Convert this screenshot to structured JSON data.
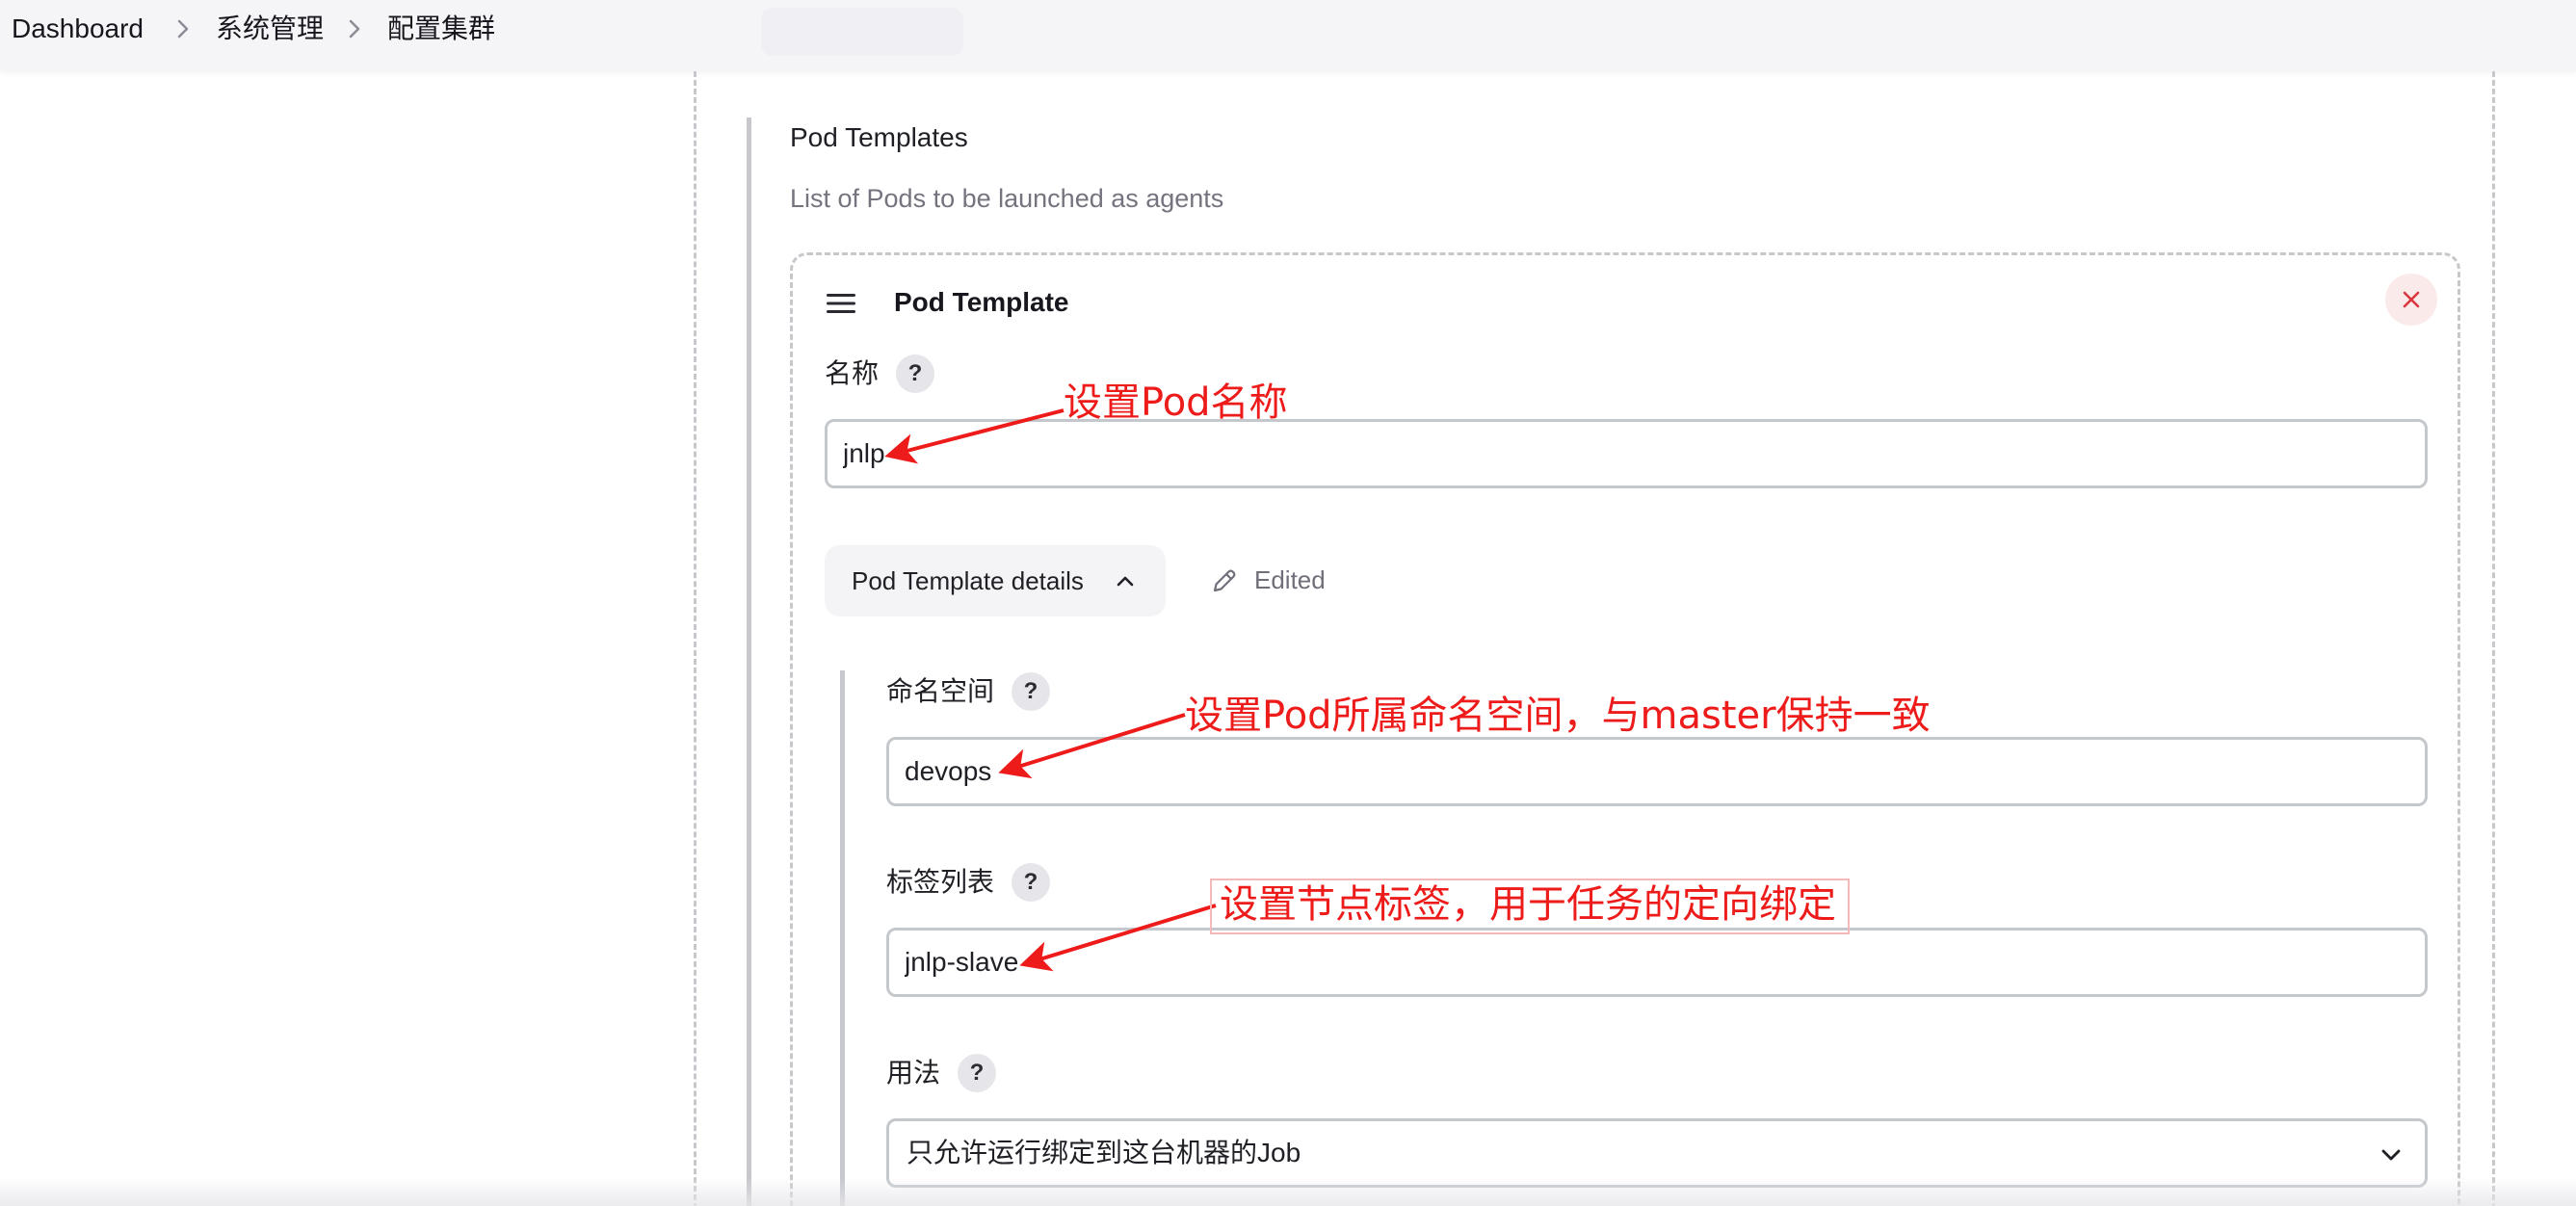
{
  "breadcrumb": {
    "items": [
      "Dashboard",
      "系统管理",
      "配置集群"
    ]
  },
  "section": {
    "title": "Pod Templates",
    "description": "List of Pods to be launched as agents"
  },
  "pod_template": {
    "card_title": "Pod Template",
    "name": {
      "label": "名称",
      "help": "?",
      "value": "jnlp"
    },
    "details_toggle": {
      "label": "Pod Template details",
      "expanded": true
    },
    "edited_status": "Edited",
    "namespace": {
      "label": "命名空间",
      "help": "?",
      "value": "devops"
    },
    "labels": {
      "label": "标签列表",
      "help": "?",
      "value": "jnlp-slave"
    },
    "usage": {
      "label": "用法",
      "help": "?",
      "selected": "只允许运行绑定到这台机器的Job"
    }
  },
  "annotations": {
    "name_note": "设置Pod名称",
    "namespace_note": "设置Pod所属命名空间，与master保持一致",
    "labels_note": "设置节点标签，用于任务的定向绑定",
    "color": "#ee1b1b"
  },
  "colors": {
    "close_icon": "#d9363e",
    "close_bg": "#fbeaea",
    "border": "#c4c8cc",
    "muted_text": "#74747f"
  },
  "icons": [
    "chevron-right-icon",
    "menu-handle-icon",
    "close-icon",
    "chevron-up-icon",
    "pencil-icon",
    "chevron-down-icon"
  ]
}
